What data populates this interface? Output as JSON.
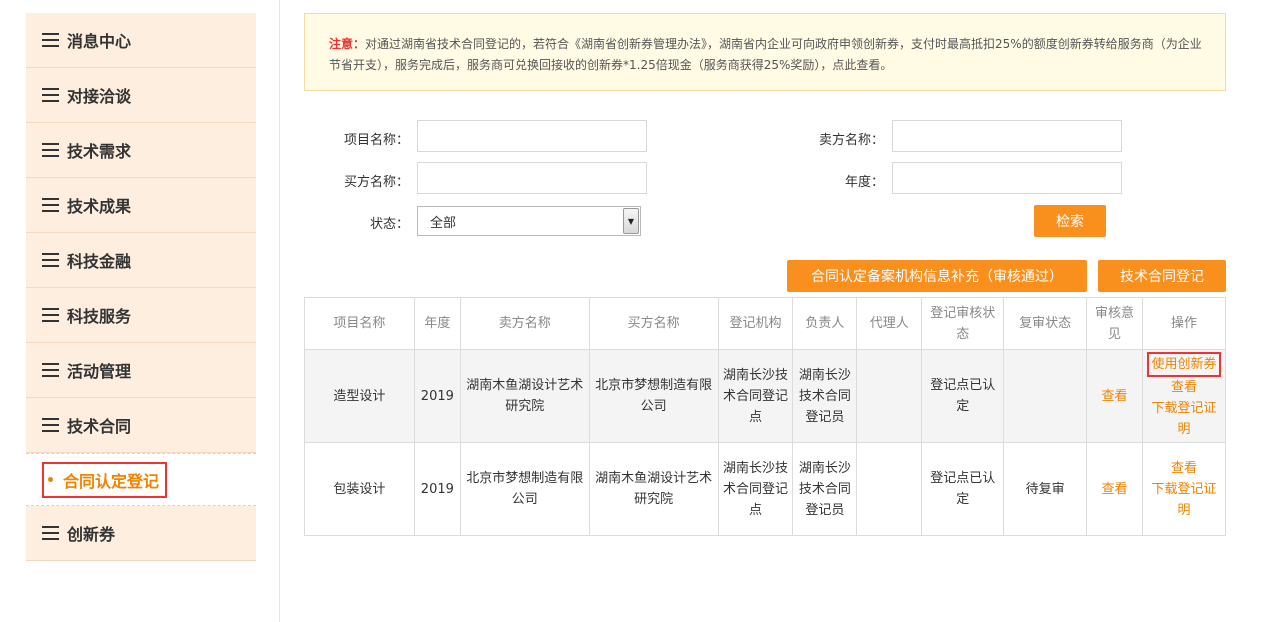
{
  "sidebar": {
    "items": [
      {
        "label": "消息中心"
      },
      {
        "label": "对接洽谈"
      },
      {
        "label": "技术需求"
      },
      {
        "label": "技术成果"
      },
      {
        "label": "科技金融"
      },
      {
        "label": "科技服务"
      },
      {
        "label": "活动管理"
      },
      {
        "label": "技术合同"
      }
    ],
    "active_sub": "合同认定登记",
    "last_item": "创新券"
  },
  "notice": {
    "label": "注意：",
    "text": "对通过湖南省技术合同登记的，若符合《湖南省创新券管理办法》，湖南省内企业可向政府申领创新券，支付时最高抵扣25%的额度创新券转给服务商（为企业节省开支），服务完成后，服务商可兑换回接收的创新券*1.25倍现金（服务商获得25%奖励），点此查看。"
  },
  "form": {
    "project_label": "项目名称：",
    "seller_label": "卖方名称：",
    "buyer_label": "买方名称：",
    "year_label": "年度：",
    "status_label": "状态：",
    "status_value": "全部",
    "search_button": "检索"
  },
  "actions": {
    "supplement_button": "合同认定备案机构信息补充（审核通过）",
    "register_button": "技术合同登记"
  },
  "table": {
    "headers": [
      "项目名称",
      "年度",
      "卖方名称",
      "买方名称",
      "登记机构",
      "负责人",
      "代理人",
      "登记审核状态",
      "复审状态",
      "审核意见",
      "操作"
    ],
    "rows": [
      {
        "project": "造型设计",
        "year": "2019",
        "seller": "湖南木鱼湖设计艺术研究院",
        "buyer": "北京市梦想制造有限公司",
        "org": "湖南长沙技术合同登记点",
        "owner": "湖南长沙技术合同登记员",
        "agent": "",
        "audit_status": "登记点已认定",
        "review_status": "",
        "opinion": "查看",
        "op_coupon": "使用创新券",
        "op_view": "查看",
        "op_download": "下载登记证明"
      },
      {
        "project": "包装设计",
        "year": "2019",
        "seller": "北京市梦想制造有限公司",
        "buyer": "湖南木鱼湖设计艺术研究院",
        "org": "湖南长沙技术合同登记点",
        "owner": "湖南长沙技术合同登记员",
        "agent": "",
        "audit_status": "登记点已认定",
        "review_status": "待复审",
        "opinion": "查看",
        "op_view": "查看",
        "op_download": "下载登记证明"
      }
    ]
  }
}
